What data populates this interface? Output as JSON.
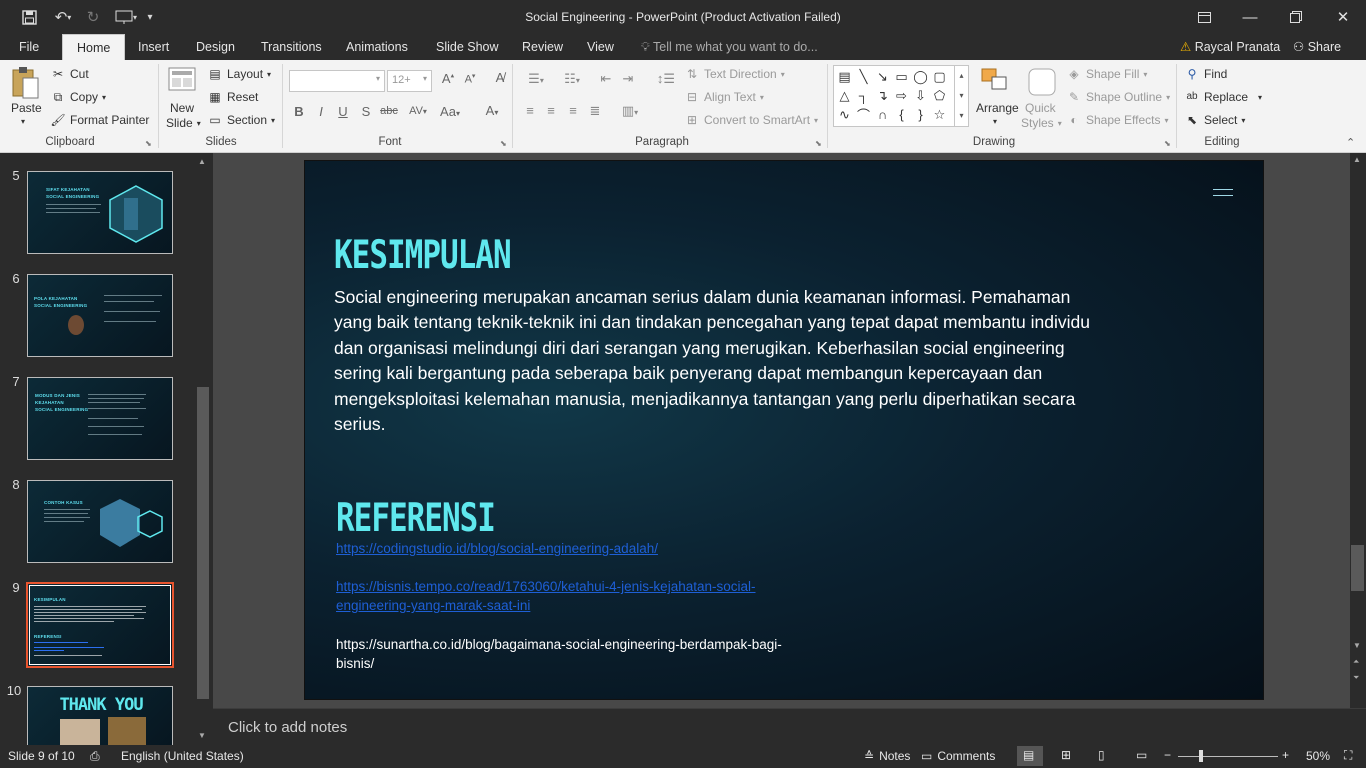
{
  "window": {
    "title": "Social Engineering - PowerPoint (Product Activation Failed)",
    "user": "Raycal Pranata",
    "share": "Share"
  },
  "tabs": [
    "File",
    "Home",
    "Insert",
    "Design",
    "Transitions",
    "Animations",
    "Slide Show",
    "Review",
    "View"
  ],
  "tell_me": "Tell me what you want to do...",
  "ribbon": {
    "clipboard": {
      "paste": "Paste",
      "cut": "Cut",
      "copy": "Copy",
      "format_painter": "Format Painter",
      "label": "Clipboard"
    },
    "slides": {
      "new_slide": "New",
      "new_slide2": "Slide",
      "layout": "Layout",
      "reset": "Reset",
      "section": "Section",
      "label": "Slides"
    },
    "font": {
      "size": "12+",
      "label": "Font",
      "bold": "B",
      "italic": "I",
      "underline": "U",
      "shadow": "S",
      "strike": "abc",
      "spacing": "AV",
      "case": "Aa",
      "color": "A"
    },
    "paragraph": {
      "text_direction": "Text Direction",
      "align_text": "Align Text",
      "smartart": "Convert to SmartArt",
      "label": "Paragraph"
    },
    "drawing": {
      "arrange": "Arrange",
      "quick": "Quick",
      "styles": "Styles",
      "shape_fill": "Shape Fill",
      "shape_outline": "Shape Outline",
      "shape_effects": "Shape Effects",
      "label": "Drawing"
    },
    "editing": {
      "find": "Find",
      "replace": "Replace",
      "select": "Select",
      "label": "Editing"
    }
  },
  "thumbnails": [
    {
      "num": "5",
      "title": "SIFAT KEJAHATAN\nSOCIAL ENGINEERING"
    },
    {
      "num": "6",
      "title": "POLA KEJAHATAN\nSOCIAL ENGINEERING"
    },
    {
      "num": "7",
      "title": "MODUS DAN JENIS\nKEJAHATAN\nSOCIAL ENGINEERING"
    },
    {
      "num": "8",
      "title": "CONTOH KASUS"
    },
    {
      "num": "9",
      "title": "KESIMPULAN"
    },
    {
      "num": "10",
      "title": "THANK YOU"
    }
  ],
  "slide": {
    "heading1": "KESIMPULAN",
    "body": "Social engineering merupakan ancaman serius dalam dunia keamanan informasi. Pemahaman yang baik tentang teknik-teknik ini dan tindakan pencegahan yang tepat dapat membantu individu dan organisasi melindungi diri dari serangan yang merugikan. Keberhasilan social engineering sering kali bergantung pada seberapa baik penyerang dapat membangun kepercayaan dan mengeksploitasi kelemahan manusia, menjadikannya tantangan yang perlu diperhatikan secara serius.",
    "heading2": "REFERENSI",
    "ref1": "https://codingstudio.id/blog/social-engineering-adalah/",
    "ref2": "https://bisnis.tempo.co/read/1763060/ketahui-4-jenis-kejahatan-social-engineering-yang-marak-saat-ini",
    "ref3": "https://sunartha.co.id/blog/bagaimana-social-engineering-berdampak-bagi-bisnis/"
  },
  "notes_placeholder": "Click to add notes",
  "status": {
    "slide_of": "Slide 9 of 10",
    "language": "English (United States)",
    "notes": "Notes",
    "comments": "Comments",
    "zoom": "50%"
  },
  "colors": {
    "accent": "#e8552f",
    "heading": "#5fe8ee",
    "link": "#1e5fd6"
  }
}
